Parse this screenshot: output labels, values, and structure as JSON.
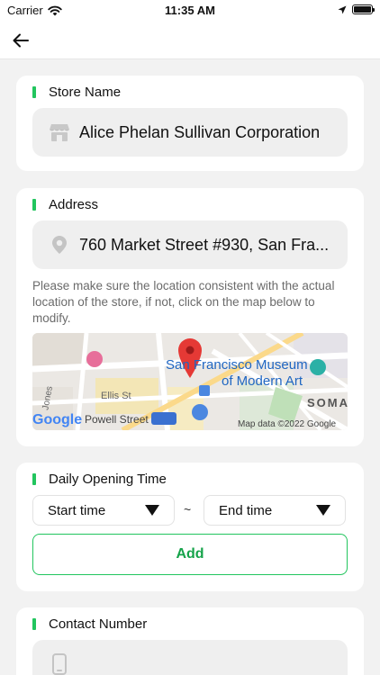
{
  "status_bar": {
    "carrier": "Carrier",
    "time": "11:35 AM"
  },
  "nav": {
    "back_icon": "arrow-left-icon"
  },
  "accent_color": "#22c55e",
  "store": {
    "title": "Store Name",
    "value": "Alice Phelan Sullivan Corporation",
    "icon": "store-icon"
  },
  "address": {
    "title": "Address",
    "value": "760 Market Street #930, San Fra...",
    "icon": "location-pin-icon",
    "hint": "Please make sure the location consistent with the actual location of the store, if not, click on the map below to modify.",
    "map": {
      "place_label_1": "San Francisco Museum",
      "place_label_2": "of Modern Art",
      "street_1": "Jones",
      "street_2": "Ellis St",
      "street_3": "Powell Street",
      "district": "SOMA",
      "brand": "Google",
      "attribution": "Map data ©2022 Google"
    }
  },
  "opening": {
    "title": "Daily Opening Time",
    "start_label": "Start time",
    "end_label": "End time",
    "separator": "~",
    "add_label": "Add"
  },
  "contact": {
    "title": "Contact Number",
    "icon": "phone-icon"
  }
}
